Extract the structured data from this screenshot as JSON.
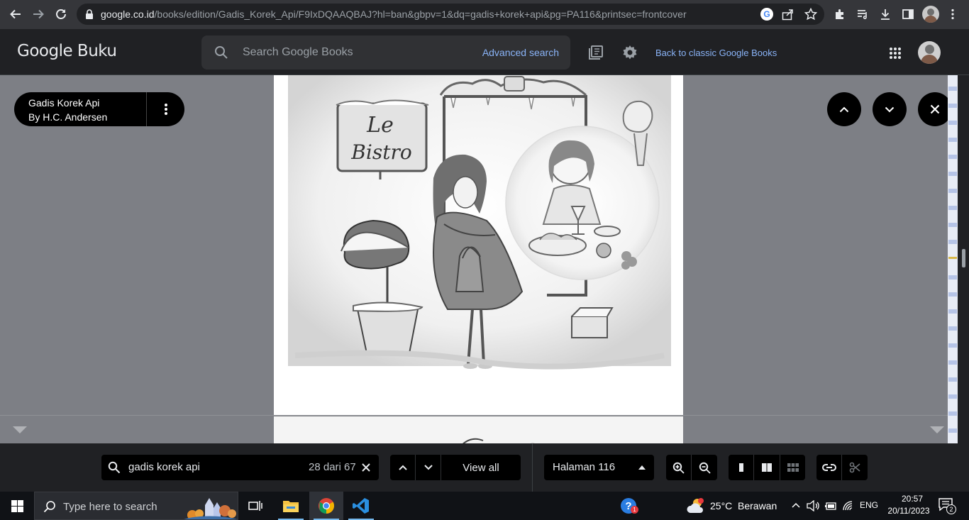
{
  "browser": {
    "url_host": "google.co.id",
    "url_path": "/books/edition/Gadis_Korek_Api/F9IxDQAAQBAJ?hl=ban&gbpv=1&dq=gadis+korek+api&pg=PA116&printsec=frontcover"
  },
  "header": {
    "logo": "Google Buku",
    "search_placeholder": "Search Google Books",
    "advanced_search": "Advanced search",
    "classic_link": "Back to classic Google Books"
  },
  "book": {
    "title": "Gadis Korek Api",
    "author": "By H.C. Andersen",
    "illustration_sign_line1": "Le",
    "illustration_sign_line2": "Bistro"
  },
  "toolbar": {
    "find_query": "gadis korek api",
    "find_count": "28 dari 67",
    "view_all": "View all",
    "page_label": "Halaman 116"
  },
  "taskbar": {
    "search_placeholder": "Type here to search",
    "weather_temp": "25°C",
    "weather_desc": "Berawan",
    "language": "ENG",
    "time": "20:57",
    "date": "20/11/2023",
    "notification_count": "2",
    "help_badge": "1"
  },
  "colors": {
    "accent_link": "#8ab4f8",
    "header_bg": "#202124",
    "viewer_bg": "#7d7f85"
  }
}
